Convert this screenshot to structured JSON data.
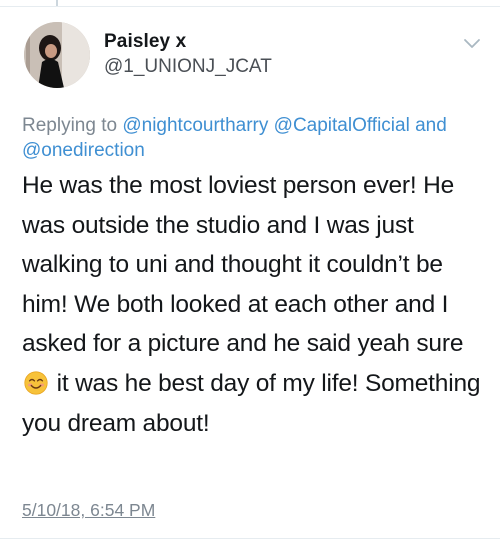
{
  "tweet": {
    "display_name": "Paisley x",
    "handle": "@1_UNIONJ_JCAT",
    "reply": {
      "prefix": "Replying to",
      "mention_1": "@nightcourtharry",
      "mention_2": "@CapitalOfficial",
      "conjunction": "and",
      "mention_3": "@onedirection"
    },
    "body": {
      "part_1": "He was the most loviest person ever! He was outside the studio and I was just walking to uni and thought it couldn’t be him! We both looked at each other and I asked for a picture and he said yeah sure",
      "emoji": "smiling-face-icon",
      "part_2": "it was he best day of my life! Something you dream about!"
    },
    "timestamp": "5/10/18, 6:54 PM"
  },
  "colors": {
    "link": "#3f8fd2",
    "muted": "#7d8791",
    "text": "#14171a",
    "emoji_face": "#f7c23a"
  }
}
